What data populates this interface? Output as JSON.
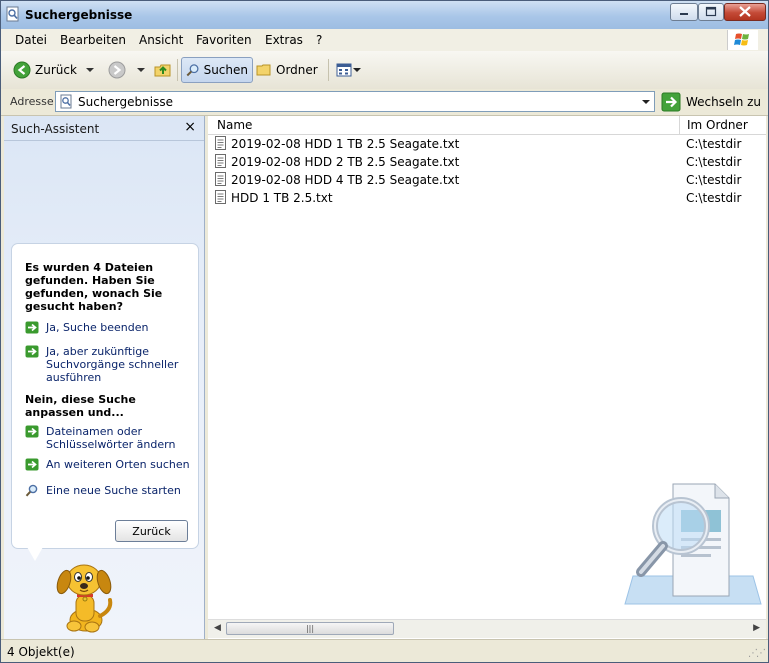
{
  "window": {
    "title": "Suchergebnisse"
  },
  "menubar": {
    "items": [
      "Datei",
      "Bearbeiten",
      "Ansicht",
      "Favoriten",
      "Extras",
      "?"
    ]
  },
  "toolbar": {
    "back_label": "Zurück",
    "search_label": "Suchen",
    "folders_label": "Ordner"
  },
  "address": {
    "label": "Adresse",
    "value": "Suchergebnisse",
    "go_label": "Wechseln zu"
  },
  "assistant": {
    "title": "Such-Assistent",
    "close_glyph": "×",
    "heading1": "Es wurden 4 Dateien gefunden. Haben Sie gefunden, wonach Sie gesucht haben?",
    "link_finish": "Ja, Suche beenden",
    "link_faster": "Ja, aber zukünftige Suchvorgänge schneller ausführen",
    "heading2": "Nein, diese Suche anpassen und...",
    "link_names": "Dateinamen oder Schlüsselwörter ändern",
    "link_places": "An weiteren Orten suchen",
    "link_new": "Eine neue Suche starten",
    "back_button": "Zurück"
  },
  "list": {
    "col_name": "Name",
    "col_folder": "Im Ordner",
    "rows": [
      {
        "name": "2019-02-08 HDD 1 TB 2.5 Seagate.txt",
        "folder": "C:\\testdir"
      },
      {
        "name": "2019-02-08 HDD 2 TB 2.5 Seagate.txt",
        "folder": "C:\\testdir"
      },
      {
        "name": "2019-02-08 HDD 4 TB 2.5 Seagate.txt",
        "folder": "C:\\testdir"
      },
      {
        "name": "HDD 1 TB 2.5.txt",
        "folder": "C:\\testdir"
      }
    ]
  },
  "status": {
    "text": "4 Objekt(e)"
  },
  "colors": {
    "accent_link": "#0a246a",
    "arrow_green": "#3a9a2e"
  }
}
